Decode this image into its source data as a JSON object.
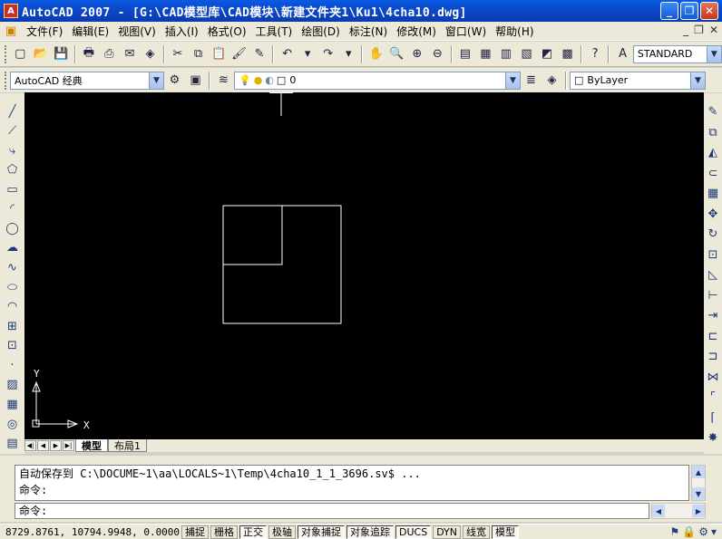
{
  "window": {
    "app_icon_label": "A",
    "title": "AutoCAD 2007 - [G:\\CAD模型库\\CAD模块\\新建文件夹1\\Ku1\\4cha10.dwg]",
    "minimize": "_",
    "maximize": "❐",
    "close": "✕"
  },
  "menu": {
    "items": [
      "文件(F)",
      "编辑(E)",
      "视图(V)",
      "插入(I)",
      "格式(O)",
      "工具(T)",
      "绘图(D)",
      "标注(N)",
      "修改(M)",
      "窗口(W)",
      "帮助(H)"
    ],
    "doc_min": "_",
    "doc_restore": "❐",
    "doc_close": "✕"
  },
  "toolbar": {
    "text_style": "STANDARD",
    "workspace": "AutoCAD 经典",
    "layer": "0",
    "color": "ByLayer"
  },
  "drawing": {
    "background": "#000000",
    "line_color": "#ffffff",
    "ucs_x_label": "X",
    "ucs_y_label": "Y"
  },
  "tabs": {
    "model": "模型",
    "layout1": "布局1"
  },
  "command": {
    "history": [
      "自动保存到 C:\\DOCUME~1\\aa\\LOCALS~1\\Temp\\4cha10_1_1_3696.sv$ ...",
      "命令:"
    ],
    "prompt": "命令:"
  },
  "status": {
    "coordinates": "8729.8761, 10794.9948, 0.0000",
    "toggles": [
      {
        "label": "捕捉",
        "on": false
      },
      {
        "label": "栅格",
        "on": false
      },
      {
        "label": "正交",
        "on": true
      },
      {
        "label": "极轴",
        "on": false
      },
      {
        "label": "对象捕捉",
        "on": true
      },
      {
        "label": "对象追踪",
        "on": true
      },
      {
        "label": "DUCS",
        "on": true
      },
      {
        "label": "DYN",
        "on": false
      },
      {
        "label": "线宽",
        "on": false
      },
      {
        "label": "模型",
        "on": true
      }
    ]
  }
}
